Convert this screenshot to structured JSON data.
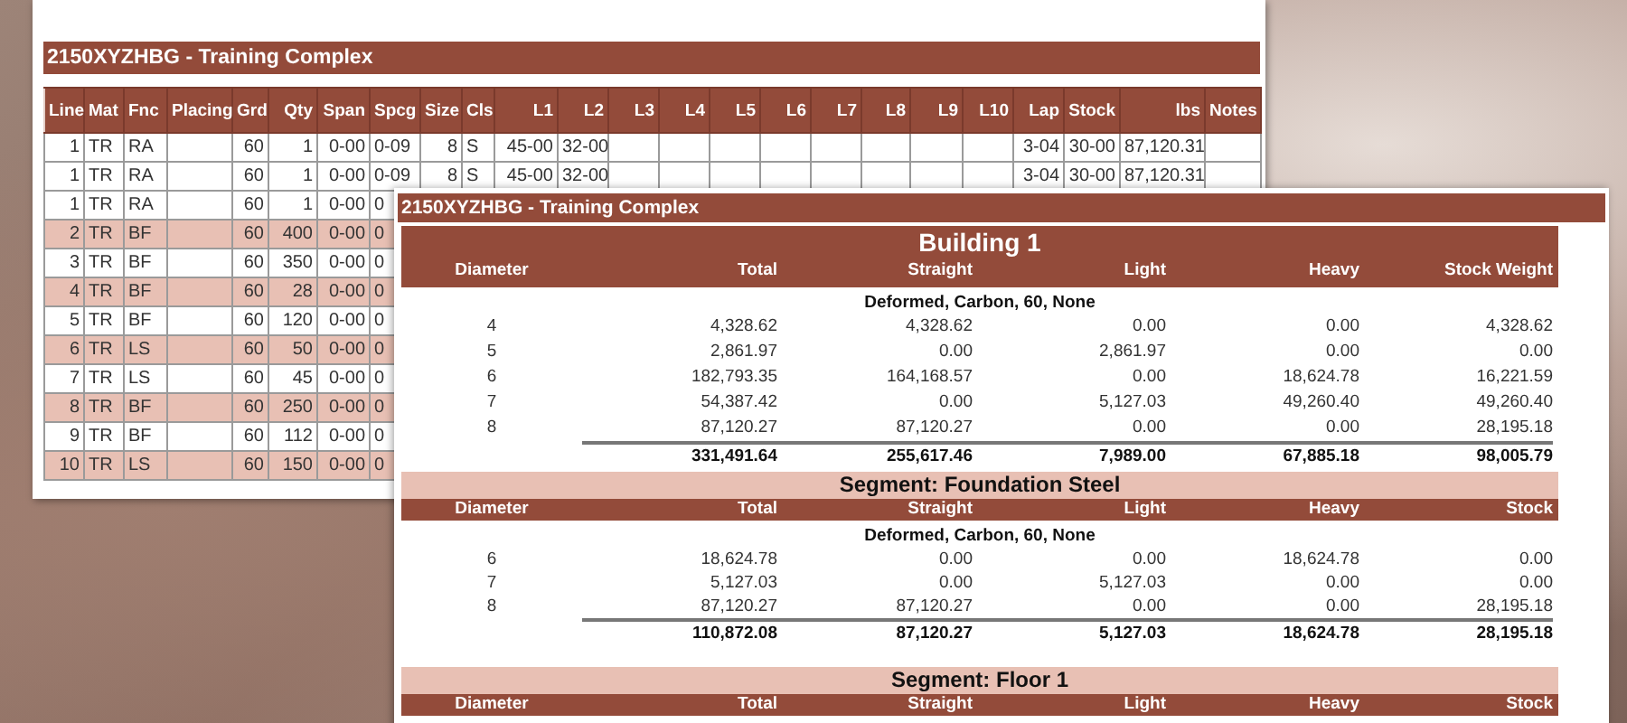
{
  "report_sheet": {
    "title": "2150XYZHBG - Training Complex",
    "columns": [
      "Line",
      "Mat",
      "Fnc",
      "Placing",
      "Grd",
      "Qty",
      "Span",
      "Spcg",
      "Size",
      "Cls",
      "L1",
      "L2",
      "L3",
      "L4",
      "L5",
      "L6",
      "L7",
      "L8",
      "L9",
      "L10",
      "Lap",
      "Stock",
      "lbs",
      "Notes"
    ],
    "rows": [
      {
        "highlighted": false,
        "cells": [
          "1",
          "TR",
          "RA",
          null,
          "60",
          "1",
          "0-00",
          "0-09",
          "8",
          "S",
          "45-00",
          "32-00",
          null,
          null,
          null,
          null,
          null,
          null,
          null,
          null,
          "3-04",
          "30-00",
          "87,120.31",
          null
        ]
      },
      {
        "highlighted": false,
        "cells": [
          "1",
          "TR",
          "RA",
          null,
          "60",
          "1",
          "0-00",
          "0-09",
          "8",
          "S",
          "45-00",
          "32-00",
          null,
          null,
          null,
          null,
          null,
          null,
          null,
          null,
          "3-04",
          "30-00",
          "87,120.31",
          null
        ]
      },
      {
        "highlighted": false,
        "cells": [
          "1",
          "TR",
          "RA",
          null,
          "60",
          "1",
          "0-00",
          "0"
        ]
      },
      {
        "highlighted": true,
        "cells": [
          "2",
          "TR",
          "BF",
          null,
          "60",
          "400",
          "0-00",
          "0"
        ]
      },
      {
        "highlighted": false,
        "cells": [
          "3",
          "TR",
          "BF",
          null,
          "60",
          "350",
          "0-00",
          "0"
        ]
      },
      {
        "highlighted": true,
        "cells": [
          "4",
          "TR",
          "BF",
          null,
          "60",
          "28",
          "0-00",
          "0"
        ]
      },
      {
        "highlighted": false,
        "cells": [
          "5",
          "TR",
          "BF",
          null,
          "60",
          "120",
          "0-00",
          "0"
        ]
      },
      {
        "highlighted": true,
        "cells": [
          "6",
          "TR",
          "LS",
          null,
          "60",
          "50",
          "0-00",
          "0"
        ]
      },
      {
        "highlighted": false,
        "cells": [
          "7",
          "TR",
          "LS",
          null,
          "60",
          "45",
          "0-00",
          "0"
        ]
      },
      {
        "highlighted": true,
        "cells": [
          "8",
          "TR",
          "BF",
          null,
          "60",
          "250",
          "0-00",
          "0"
        ]
      },
      {
        "highlighted": false,
        "cells": [
          "9",
          "TR",
          "BF",
          null,
          "60",
          "112",
          "0-00",
          "0"
        ]
      },
      {
        "highlighted": true,
        "cells": [
          "10",
          "TR",
          "LS",
          null,
          "60",
          "150",
          "0-00",
          "0"
        ]
      }
    ]
  },
  "summary_sheet": {
    "title": "2150XYZHBG - Training Complex",
    "building": {
      "title": "Building 1",
      "columns": [
        "Diameter",
        "Total",
        "Straight",
        "Light",
        "Heavy",
        "Stock Weight"
      ],
      "group_label": "Deformed, Carbon, 60, None",
      "rows": [
        [
          "4",
          "4,328.62",
          "4,328.62",
          "0.00",
          "0.00",
          "4,328.62"
        ],
        [
          "5",
          "2,861.97",
          "0.00",
          "2,861.97",
          "0.00",
          "0.00"
        ],
        [
          "6",
          "182,793.35",
          "164,168.57",
          "0.00",
          "18,624.78",
          "16,221.59"
        ],
        [
          "7",
          "54,387.42",
          "0.00",
          "5,127.03",
          "49,260.40",
          "49,260.40"
        ],
        [
          "8",
          "87,120.27",
          "87,120.27",
          "0.00",
          "0.00",
          "28,195.18"
        ]
      ],
      "totals": [
        "331,491.64",
        "255,617.46",
        "7,989.00",
        "67,885.18",
        "98,005.79"
      ]
    },
    "segments": [
      {
        "title": "Segment: Foundation Steel",
        "columns": [
          "Diameter",
          "Total",
          "Straight",
          "Light",
          "Heavy",
          "Stock"
        ],
        "group_label": "Deformed, Carbon, 60, None",
        "rows": [
          [
            "6",
            "18,624.78",
            "0.00",
            "0.00",
            "18,624.78",
            "0.00"
          ],
          [
            "7",
            "5,127.03",
            "0.00",
            "5,127.03",
            "0.00",
            "0.00"
          ],
          [
            "8",
            "87,120.27",
            "87,120.27",
            "0.00",
            "0.00",
            "28,195.18"
          ]
        ],
        "totals": [
          "110,872.08",
          "87,120.27",
          "5,127.03",
          "18,624.78",
          "28,195.18"
        ]
      },
      {
        "title": "Segment: Floor 1",
        "columns": [
          "Diameter",
          "Total",
          "Straight",
          "Light",
          "Heavy",
          "Stock"
        ]
      }
    ]
  }
}
